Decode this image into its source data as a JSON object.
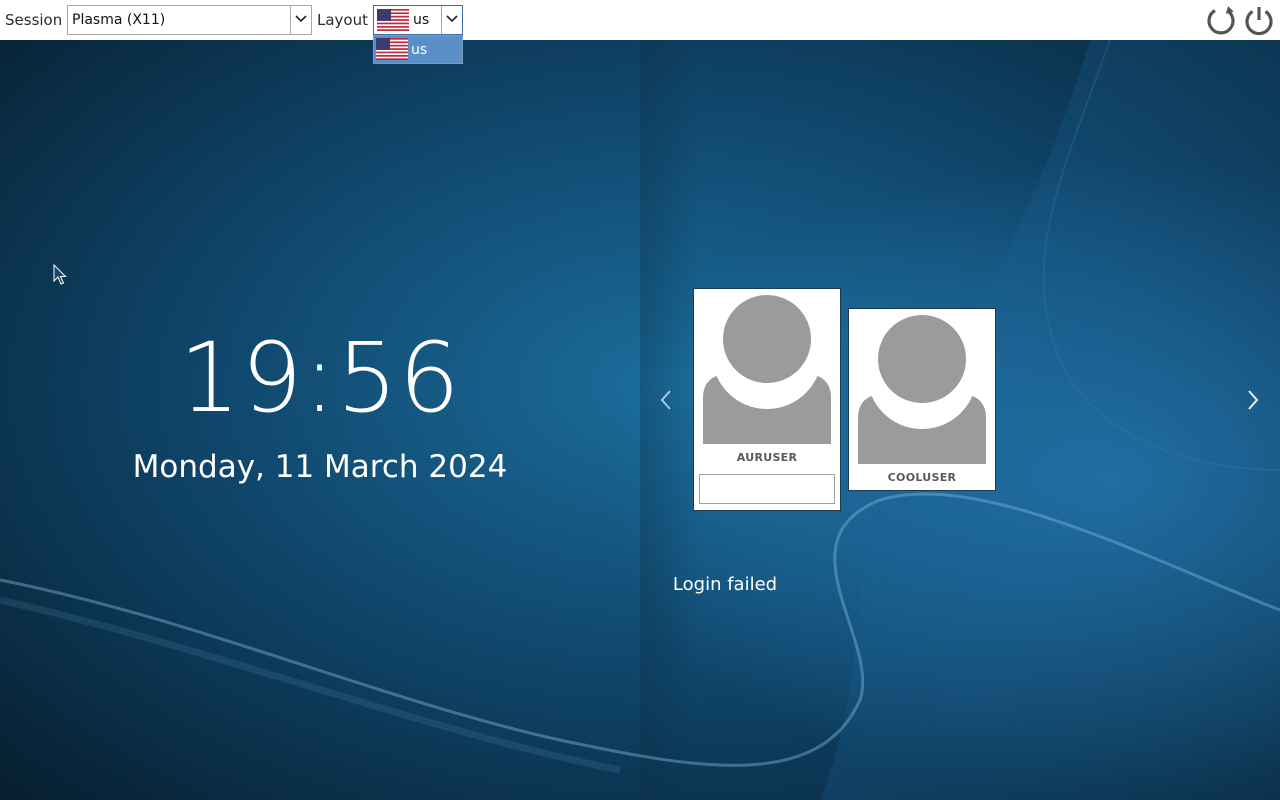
{
  "session": {
    "label": "Session",
    "selected": "Plasma (X11)",
    "icon": "chevron-down-icon"
  },
  "layout": {
    "label": "Layout",
    "selected": "us",
    "flag": "us-flag-icon",
    "dropdown_options": [
      "us"
    ]
  },
  "top_actions": {
    "reboot_icon": "reboot-icon",
    "shutdown_icon": "power-icon"
  },
  "clock": {
    "time": "19:56",
    "date": "Monday, 11 March 2024"
  },
  "users": [
    {
      "name": "AURUSER",
      "selected": true,
      "password_value": ""
    },
    {
      "name": "COOLUSER",
      "selected": false
    }
  ],
  "navigation": {
    "prev_icon": "chevron-left-icon",
    "next_icon": "chevron-right-icon"
  },
  "status": {
    "message": "Login failed"
  },
  "colors": {
    "dropdown_highlight": "#5b8fc7",
    "avatar_gray": "#9b9b9b",
    "background": "#0c3550"
  }
}
